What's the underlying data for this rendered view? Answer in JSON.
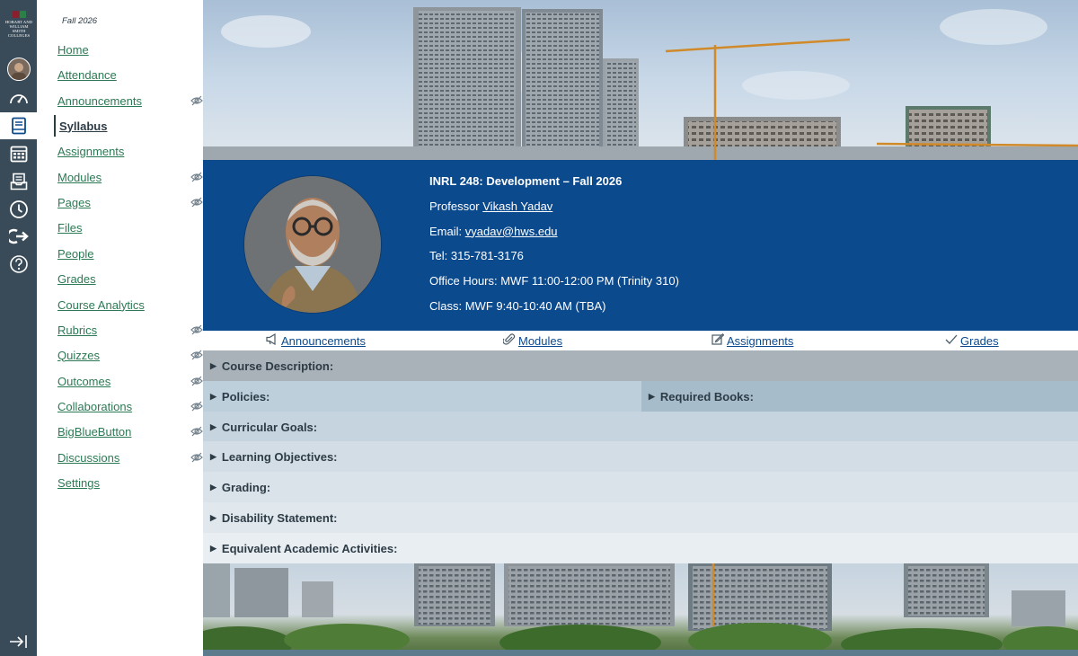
{
  "global_nav": {
    "logo_text": "HOBART AND\nWILLIAM SMITH\nCOLLEGES",
    "items": [
      {
        "name": "account",
        "icon": "account-avatar"
      },
      {
        "name": "dashboard",
        "icon": "dashboard-icon"
      },
      {
        "name": "courses",
        "icon": "courses-icon"
      },
      {
        "name": "calendar",
        "icon": "calendar-icon"
      },
      {
        "name": "inbox",
        "icon": "inbox-icon"
      },
      {
        "name": "history",
        "icon": "history-icon"
      },
      {
        "name": "commons",
        "icon": "commons-icon"
      },
      {
        "name": "help",
        "icon": "help-icon"
      },
      {
        "name": "collapse",
        "icon": "expand-nav-icon"
      }
    ]
  },
  "course_nav": {
    "term": "Fall 2026",
    "items": [
      {
        "label": "Home",
        "hidden": false
      },
      {
        "label": "Attendance",
        "hidden": false
      },
      {
        "label": "Announcements",
        "hidden": true
      },
      {
        "label": "Syllabus",
        "hidden": false,
        "active": true
      },
      {
        "label": "Assignments",
        "hidden": false
      },
      {
        "label": "Modules",
        "hidden": true
      },
      {
        "label": "Pages",
        "hidden": true
      },
      {
        "label": "Files",
        "hidden": false
      },
      {
        "label": "People",
        "hidden": false
      },
      {
        "label": "Grades",
        "hidden": false
      },
      {
        "label": "Course Analytics",
        "hidden": false
      },
      {
        "label": "Rubrics",
        "hidden": true
      },
      {
        "label": "Quizzes",
        "hidden": true
      },
      {
        "label": "Outcomes",
        "hidden": true
      },
      {
        "label": "Collaborations",
        "hidden": true
      },
      {
        "label": "BigBlueButton",
        "hidden": true
      },
      {
        "label": "Discussions",
        "hidden": true
      },
      {
        "label": "Settings",
        "hidden": false
      }
    ]
  },
  "banner": {
    "course_title": "INRL 248: Development – Fall 2026",
    "professor_prefix": "Professor ",
    "professor_name": "Vikash Yadav",
    "email_prefix": "Email: ",
    "email": "vyadav@hws.edu",
    "tel": "Tel: 315-781-3176",
    "office_hours": "Office Hours: MWF 11:00-12:00 PM (Trinity 310)",
    "class": "Class: MWF 9:40-10:40 AM (TBA)"
  },
  "quick_links": [
    {
      "label": "Announcements",
      "icon": "megaphone-icon"
    },
    {
      "label": "Modules",
      "icon": "paperclip-icon"
    },
    {
      "label": "Assignments",
      "icon": "edit-icon"
    },
    {
      "label": "Grades",
      "icon": "checkmark-icon"
    }
  ],
  "sections": {
    "course_description": "Course Description:",
    "policies": "Policies:",
    "required_books": "Required Books:",
    "curricular_goals": "Curricular Goals:",
    "learning_objectives": "Learning Objectives:",
    "grading": "Grading:",
    "disability_statement": "Disability Statement:",
    "equivalent_activities": "Equivalent Academic Activities:"
  },
  "colors": {
    "global_nav_bg": "#394b58",
    "banner_bg": "#0c4a8e",
    "link_green": "#2b7a54",
    "section_dark": "#a9b1b9",
    "section_mid": "#bccfdb",
    "section_light": "#d5dfe8"
  }
}
